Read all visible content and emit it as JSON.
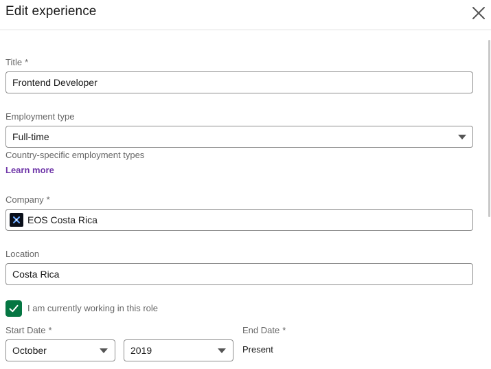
{
  "dialog": {
    "title": "Edit experience",
    "close_icon": "close-icon"
  },
  "form": {
    "title": {
      "label": "Title",
      "required_mark": "*",
      "value": "Frontend Developer"
    },
    "employment_type": {
      "label": "Employment type",
      "value": "Full-time",
      "helper": "Country-specific employment types",
      "link": "Learn more"
    },
    "company": {
      "label": "Company",
      "required_mark": "*",
      "value": "EOS Costa Rica",
      "logo_icon": "company-logo-icon"
    },
    "location": {
      "label": "Location",
      "value": "Costa Rica"
    },
    "current_role": {
      "checked": true,
      "label": "I am currently working in this role"
    },
    "start_date": {
      "label": "Start Date",
      "required_mark": "*",
      "month": "October",
      "year": "2019"
    },
    "end_date": {
      "label": "End Date",
      "required_mark": "*",
      "value": "Present"
    }
  },
  "colors": {
    "accent_green": "#057642",
    "link_purple": "#6f36a8"
  }
}
